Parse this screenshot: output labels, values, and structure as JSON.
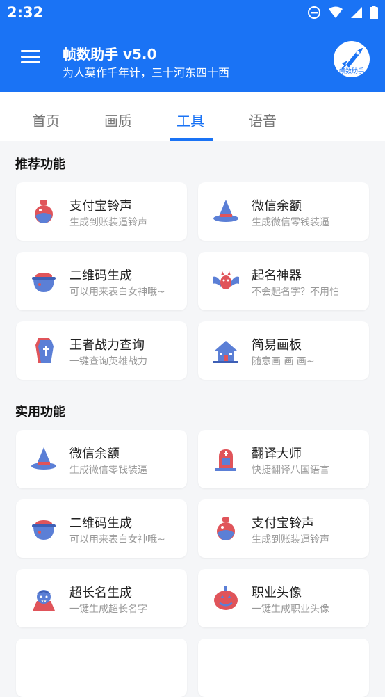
{
  "status_bar": {
    "time": "2:32"
  },
  "app_bar": {
    "title": "帧数助手 v5.0",
    "subtitle": "为人莫作千年计，三十河东四十西",
    "logo_text": "帧数助手"
  },
  "tabs": [
    {
      "label": "首页",
      "active": false
    },
    {
      "label": "画质",
      "active": false
    },
    {
      "label": "工具",
      "active": true
    },
    {
      "label": "语音",
      "active": false
    }
  ],
  "sections": [
    {
      "title": "推荐功能",
      "items": [
        {
          "title": "支付宝铃声",
          "desc": "生成到账装逼铃声",
          "icon": "potion-icon"
        },
        {
          "title": "微信余额",
          "desc": "生成微信零钱装逼",
          "icon": "witch-hat-icon"
        },
        {
          "title": "二维码生成",
          "desc": "可以用来表白女神哦~",
          "icon": "cauldron-icon"
        },
        {
          "title": "起名神器",
          "desc": "不会起名字？不用怕",
          "icon": "bat-icon"
        },
        {
          "title": "王者战力查询",
          "desc": "一键查询英雄战力",
          "icon": "coffin-icon"
        },
        {
          "title": "简易画板",
          "desc": "随意画 画 画~",
          "icon": "haunted-house-icon"
        }
      ]
    },
    {
      "title": "实用功能",
      "items": [
        {
          "title": "微信余额",
          "desc": "生成微信零钱装逼",
          "icon": "witch-hat-icon"
        },
        {
          "title": "翻译大师",
          "desc": "快捷翻译八国语言",
          "icon": "tombstone-icon"
        },
        {
          "title": "二维码生成",
          "desc": "可以用来表白女神哦~",
          "icon": "cauldron-icon"
        },
        {
          "title": "支付宝铃声",
          "desc": "生成到账装逼铃声",
          "icon": "potion-icon"
        },
        {
          "title": "超长名生成",
          "desc": "一键生成超长名字",
          "icon": "vampire-icon"
        },
        {
          "title": "职业头像",
          "desc": "一键生成职业头像",
          "icon": "pumpkin-icon"
        }
      ]
    }
  ],
  "colors": {
    "primary": "#1a73f5",
    "icon_blue": "#5b7fd6",
    "icon_red": "#e0545a"
  }
}
